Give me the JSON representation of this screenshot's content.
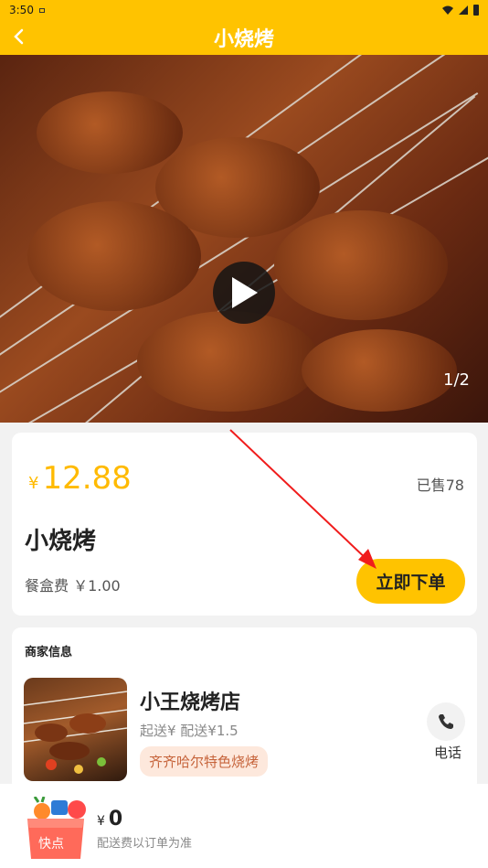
{
  "status_bar": {
    "time": "3:50"
  },
  "app_bar": {
    "title": "小烧烤"
  },
  "media": {
    "pager": "1/2"
  },
  "product": {
    "price_symbol": "¥",
    "price": "12.88",
    "sold": "已售78",
    "name": "小烧烤",
    "box_fee": "餐盒费 ￥1.00",
    "order_button": "立即下单"
  },
  "merchant": {
    "section_title": "商家信息",
    "name": "小王烧烤店",
    "fees": "起送¥  配送¥1.5",
    "tag": "齐齐哈尔特色烧烤",
    "phone_label": "电话"
  },
  "cart": {
    "currency": "¥",
    "total": "0",
    "delivery_note": "配送费以订单为准",
    "logo_text": "快点"
  },
  "colors": {
    "accent": "#ffc300",
    "price": "#ffba00",
    "tag_bg": "#fde8dc",
    "tag_text": "#c6643b",
    "annotation_arrow": "#f01c1c"
  }
}
